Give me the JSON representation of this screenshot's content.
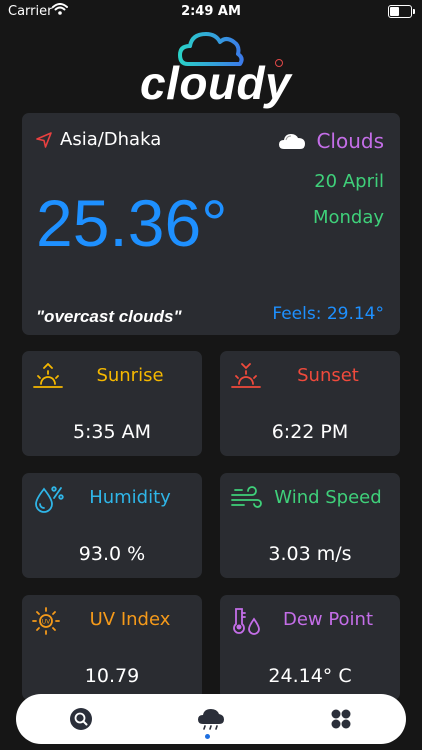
{
  "status_bar": {
    "carrier": "Carrier",
    "time": "2:49 AM"
  },
  "logo": {
    "text": "cloudy"
  },
  "weather": {
    "location": "Asia/Dhaka",
    "condition": "Clouds",
    "date": "20 April",
    "day": "Monday",
    "temperature": "25.36°",
    "description": "\"overcast clouds\"",
    "feels_like": "Feels: 29.14°"
  },
  "tiles": [
    {
      "label": "Sunrise",
      "value": "5:35 AM",
      "icon": "sunrise-icon",
      "color": "#f5b800"
    },
    {
      "label": "Sunset",
      "value": "6:22 PM",
      "icon": "sunset-icon",
      "color": "#f04a3c"
    },
    {
      "label": "Humidity",
      "value": "93.0 %",
      "icon": "humidity-icon",
      "color": "#2fb6e8"
    },
    {
      "label": "Wind Speed",
      "value": "3.03 m/s",
      "icon": "wind-icon",
      "color": "#3fd07a"
    },
    {
      "label": "UV Index",
      "value": "10.79",
      "icon": "uv-icon",
      "color": "#f59a1a"
    },
    {
      "label": "Dew Point",
      "value": "24.14° C",
      "icon": "dew-point-icon",
      "color": "#c46ee8"
    }
  ],
  "colors": {
    "background": "#161616",
    "card": "#2a2c31",
    "temperature": "#1e90ff",
    "condition": "#c46ee8",
    "date": "#3fd07a",
    "active_tab": "#1e6fe0"
  },
  "nav": {
    "items": [
      {
        "icon": "search-icon"
      },
      {
        "icon": "cloud-rain-icon",
        "active": true
      },
      {
        "icon": "grid-icon"
      }
    ]
  }
}
